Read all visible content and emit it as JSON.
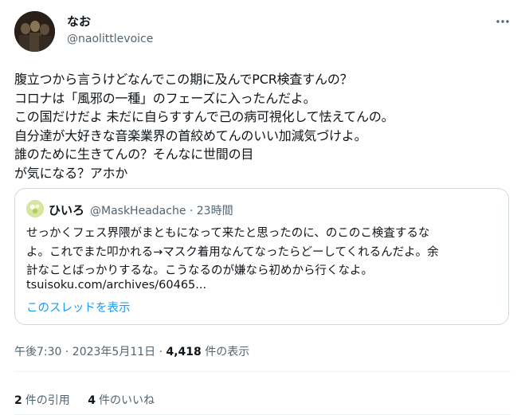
{
  "author": {
    "display_name": "なお",
    "handle": "@naolittlevoice"
  },
  "tweet": {
    "text": "腹立つから言うけどなんでこの期に及んでPCR検査すんの？\nコロナは「風邪の一種」のフェーズに入ったんだよ。\nこの国だけだよ 未だに自らすすんで己の病可視化して怯えてんの。\n自分達が大好きな音楽業界の首絞めてんのいい加減気づけよ。\n誰のために生きてんの？そんなに世間の目\nが気になる？アホか"
  },
  "quoted": {
    "display_name": "ひいろ",
    "handle_time": "@MaskHeadache · 23時間",
    "text": "せっかくフェス界隈がまともになって来たと思ったのに、のこのこ検査するな\nよ。これでまた叩かれる→マスク着用なんてなったらどーしてくれるんだよ。余\n計なことばっかりするな。こうなるのが嫌なら初めから行くなよ。",
    "link": "tsuisoku.com/archives/60465...",
    "thread_label": "このスレッドを表示"
  },
  "meta": {
    "timestamp": "午後7:30 · 2023年5月11日 · ",
    "views_count": "4,418",
    "views_label": " 件の表示"
  },
  "stats": {
    "quotes_count": "2",
    "quotes_label": "件の引用",
    "likes_count": "4",
    "likes_label": "件のいいね"
  },
  "icons": {
    "more": "more-horizontal-icon"
  },
  "colors": {
    "link_blue": "#1d9bf0",
    "secondary_text": "#536471",
    "border": "#cfd9de"
  }
}
